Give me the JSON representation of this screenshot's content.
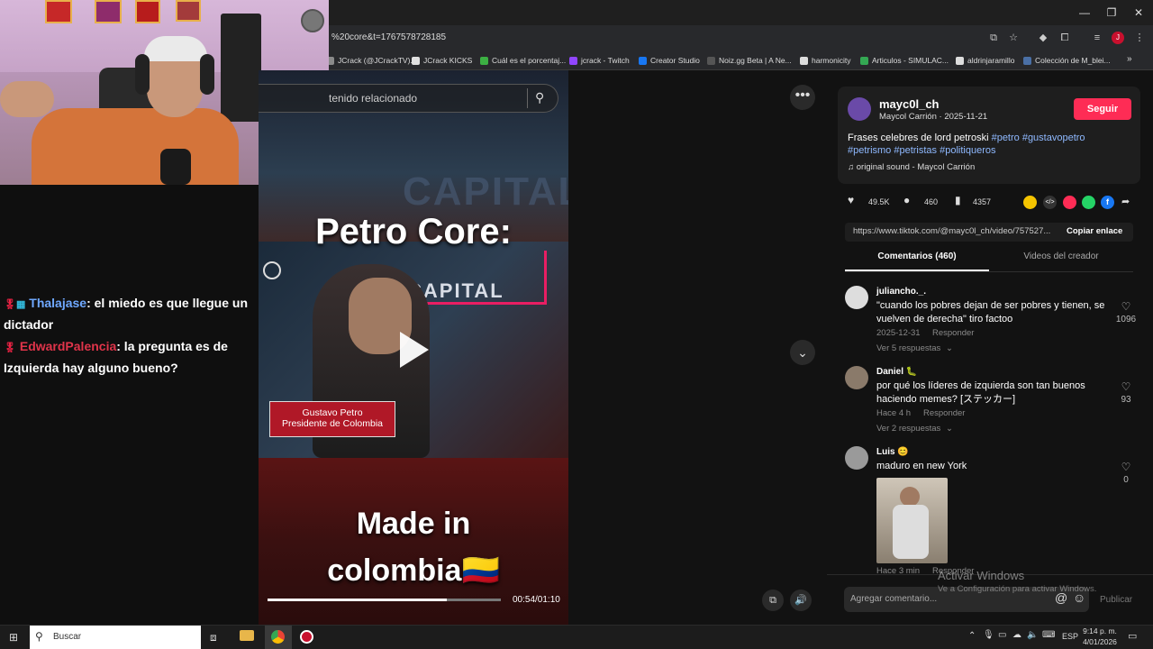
{
  "browser": {
    "url": "%20core&t=1767578728185",
    "bookmarks": [
      {
        "label": "JCrack (@JCrackTV)...",
        "color": "#8a8a8a"
      },
      {
        "label": "JCrack KICKS",
        "color": "#e0e0e0"
      },
      {
        "label": "Cuál es el porcentaj...",
        "color": "#3cb043"
      },
      {
        "label": "jcrack - Twitch",
        "color": "#9146ff"
      },
      {
        "label": "Creator Studio",
        "color": "#1877f2"
      },
      {
        "label": "Noiz.gg Beta | A Ne...",
        "color": "#555"
      },
      {
        "label": "harmonicity",
        "color": "#ddd"
      },
      {
        "label": "Articulos - SIMULAC...",
        "color": "#34a853"
      },
      {
        "label": "aldrinjaramillo",
        "color": "#ddd"
      },
      {
        "label": "Colección de M_blei...",
        "color": "#4a6fa5"
      }
    ],
    "more_bookmarks": "»"
  },
  "chat": {
    "messages": [
      {
        "user": "Thalajase",
        "user_color": "#6fa8ff",
        "text": ": el miedo es que llegue un dictador"
      },
      {
        "user": "EdwardPalencia",
        "user_color": "#e0344a",
        "text": ": la pregunta es de Izquierda hay alguno bueno?"
      }
    ]
  },
  "video": {
    "search_placeholder": "tenido relacionado",
    "caption_top": "Petro Core:",
    "channel_logo": "CAPITAL",
    "lower_third_line1": "Gustavo Petro",
    "lower_third_line2": "Presidente de Colombia",
    "caption_bottom": "Made in\ncolombia🇨🇴",
    "time": "00:54/01:10",
    "progress": 0.77
  },
  "post": {
    "username": "mayc0l_ch",
    "subtitle": "Maycol Carrión · 2025-11-21",
    "follow_label": "Seguir",
    "description": "Frases celebres de lord petroski",
    "hashtags": "#petro #gustavopetro #petrismo #petristas #politiqueros",
    "sound": "original sound - Maycol Carrión",
    "likes": "49.5K",
    "comments": "460",
    "saves": "4357",
    "share_url": "https://www.tiktok.com/@mayc0l_ch/video/757527...",
    "copy_label": "Copiar enlace",
    "tab_comments": "Comentarios (460)",
    "tab_videos": "Videos del creador",
    "accent": "#fe2c55",
    "hashtag_color": "#8fb9ff"
  },
  "comments": [
    {
      "name": "juliancho._.",
      "text": "\"cuando los pobres dejan de ser pobres y tienen, se vuelven de derecha\" tiro factoo",
      "date": "2025-12-31",
      "reply": "Responder",
      "more": "Ver 5 respuestas",
      "likes": "1096"
    },
    {
      "name": "Daniel 🐛",
      "text": "por qué los líderes de izquierda son tan buenos haciendo memes? [ステッカー]",
      "date": "Hace 4 h",
      "reply": "Responder",
      "more": "Ver 2 respuestas",
      "likes": "93"
    },
    {
      "name": "Luis 😊",
      "text": "maduro en new York",
      "date": "Hace 3 min",
      "reply": "Responder",
      "more": "",
      "likes": "0"
    }
  ],
  "composer": {
    "placeholder": "Agregar comentario...",
    "post_label": "Publicar"
  },
  "watermark": {
    "line1": "Activar Windows",
    "line2": "Ve a Configuración para activar Windows."
  },
  "taskbar": {
    "search_placeholder": "Buscar",
    "lang": "ESP",
    "time": "9:14 p. m.",
    "date": "4/01/2026"
  }
}
